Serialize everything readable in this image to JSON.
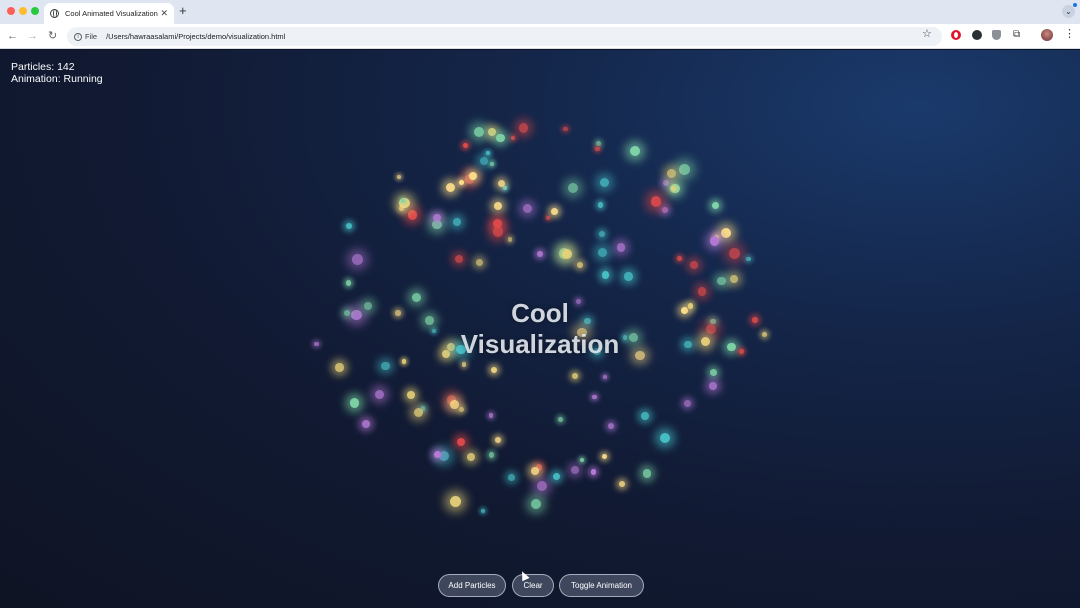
{
  "browser": {
    "tab_title": "Cool Animated Visualization",
    "address_scheme": "File",
    "url": "/Users/hawraasalami/Projects/demo/visualization.html"
  },
  "stats": {
    "particles_line": "Particles: 142",
    "animation_line": "Animation: Running"
  },
  "title": {
    "line1": "Cool",
    "line2": "Visualization"
  },
  "controls": {
    "add_label": "Add Particles",
    "clear_label": "Clear",
    "toggle_label": "Toggle Animation"
  },
  "particle_colors": [
    "#49c3c9",
    "#e14a4a",
    "#b57ad6",
    "#e8d27a",
    "#7fd6a8",
    "#ffe08a"
  ]
}
